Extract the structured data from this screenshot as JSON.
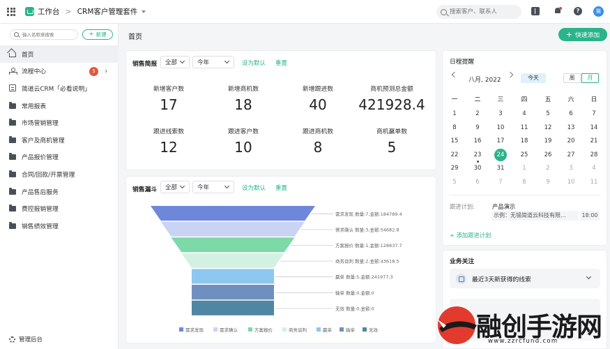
{
  "topbar": {
    "brand": "工作台",
    "separator": ">",
    "app_name": "CRM客户管理套件",
    "search_placeholder": "搜索客户、联系人",
    "avatar_text": "猫"
  },
  "sidebar": {
    "search_placeholder": "输入名称来搜索",
    "new_label": "新建",
    "collapse_glyph": "«",
    "items": [
      {
        "label": "首页",
        "icon": "home-icon"
      },
      {
        "label": "流程中心",
        "icon": "flow-icon",
        "badge": "5"
      },
      {
        "label": "简道云CRM「必看说明」",
        "icon": "document-icon"
      },
      {
        "label": "常用报表",
        "icon": "folder-icon"
      },
      {
        "label": "市场营销管理",
        "icon": "folder-icon"
      },
      {
        "label": "客户及商机管理",
        "icon": "folder-icon"
      },
      {
        "label": "产品报价管理",
        "icon": "folder-icon"
      },
      {
        "label": "合同/回款/开票管理",
        "icon": "folder-icon"
      },
      {
        "label": "产品售后服务",
        "icon": "folder-icon"
      },
      {
        "label": "费控报销管理",
        "icon": "folder-icon"
      },
      {
        "label": "销售绩效管理",
        "icon": "folder-icon"
      }
    ],
    "footer": "管理后台"
  },
  "main": {
    "page_title": "首页",
    "quick_add": "快速添加"
  },
  "sales_brief": {
    "title": "销售简报",
    "scope": "全部",
    "period": "今年",
    "set_default": "设为默认",
    "reset": "重置",
    "stats": [
      {
        "label": "新增客户数",
        "value": "17"
      },
      {
        "label": "新增商机数",
        "value": "18"
      },
      {
        "label": "新增跟进数",
        "value": "40"
      },
      {
        "label": "商机预测总金额",
        "value": "421928.4"
      },
      {
        "label": "跟进线索数",
        "value": "12"
      },
      {
        "label": "跟进客户数",
        "value": "10"
      },
      {
        "label": "跟进商机数",
        "value": "8"
      },
      {
        "label": "商机赢单数",
        "value": "5"
      }
    ]
  },
  "funnel": {
    "title": "销售漏斗",
    "scope": "全部",
    "period": "今年",
    "set_default": "设为默认",
    "reset": "重置"
  },
  "chart_data": {
    "type": "funnel",
    "series": [
      {
        "name": "需求发现",
        "label": "需求发现 数量:7,金额:184789.4",
        "count": 7,
        "amount": 184789.4,
        "color": "#6e87db"
      },
      {
        "name": "需求确认",
        "label": "需求确认 数量:3,金额:54682.8",
        "count": 3,
        "amount": 54682.8,
        "color": "#c9d4f4"
      },
      {
        "name": "方案报价",
        "label": "方案报价 数量:1,金额:128837.7",
        "count": 1,
        "amount": 128837.7,
        "color": "#7dd9a8"
      },
      {
        "name": "商务谈判",
        "label": "商务谈判 数量:2,金额:43618.5",
        "count": 2,
        "amount": 43618.5,
        "color": "#d3f1e3"
      },
      {
        "name": "赢单",
        "label": "赢单 数量:5,金额:241977.3",
        "count": 5,
        "amount": 241977.3,
        "color": "#8ec7f0"
      },
      {
        "name": "输单",
        "label": "输单 数量:0,金额:0",
        "count": 0,
        "amount": 0,
        "color": "#6f8fbf"
      },
      {
        "name": "无效",
        "label": "无效 数量:0,金额:0",
        "count": 0,
        "amount": 0,
        "color": "#4f86a3"
      }
    ],
    "legend_position": "bottom"
  },
  "calendar": {
    "title": "日程提醒",
    "month_label": "八月, 2022",
    "today_label": "今天",
    "week_btn": "周",
    "month_btn": "月",
    "weekdays": [
      "一",
      "二",
      "三",
      "四",
      "五",
      "六",
      "日"
    ],
    "weeks": [
      [
        {
          "d": "1"
        },
        {
          "d": "2"
        },
        {
          "d": "3"
        },
        {
          "d": "4"
        },
        {
          "d": "5"
        },
        {
          "d": "6"
        },
        {
          "d": "7"
        }
      ],
      [
        {
          "d": "8"
        },
        {
          "d": "9"
        },
        {
          "d": "10"
        },
        {
          "d": "11"
        },
        {
          "d": "12"
        },
        {
          "d": "13"
        },
        {
          "d": "14"
        }
      ],
      [
        {
          "d": "15"
        },
        {
          "d": "16"
        },
        {
          "d": "17"
        },
        {
          "d": "18"
        },
        {
          "d": "19"
        },
        {
          "d": "20"
        },
        {
          "d": "21"
        }
      ],
      [
        {
          "d": "22"
        },
        {
          "d": "23",
          "dot": true
        },
        {
          "d": "24",
          "today": true
        },
        {
          "d": "25"
        },
        {
          "d": "26"
        },
        {
          "d": "27"
        },
        {
          "d": "28"
        }
      ],
      [
        {
          "d": "29"
        },
        {
          "d": "30"
        },
        {
          "d": "31"
        },
        {
          "d": "1",
          "other": true
        },
        {
          "d": "2",
          "other": true
        },
        {
          "d": "3",
          "other": true
        },
        {
          "d": "4",
          "other": true
        }
      ],
      [
        {
          "d": "5",
          "other": true
        },
        {
          "d": "6",
          "other": true
        },
        {
          "d": "7",
          "other": true
        },
        {
          "d": "8",
          "other": true
        },
        {
          "d": "9",
          "other": true
        },
        {
          "d": "10",
          "other": true
        },
        {
          "d": "11",
          "other": true
        }
      ]
    ],
    "follow_label": "跟进计划:",
    "follow_title": "产品演示",
    "follow_item": "示例：无锡简道云科技有限...",
    "follow_time": "18:00",
    "add_follow": "+ 添加跟进计划"
  },
  "business": {
    "title": "业务关注",
    "item": "最近3天新获得的线索"
  },
  "watermark": {
    "text": "融创手游网",
    "url": "www.zzrcfund.com"
  },
  "colors": {
    "accent": "#2bb38a",
    "badge": "#e2553f",
    "avatar": "#3d8ee8"
  }
}
